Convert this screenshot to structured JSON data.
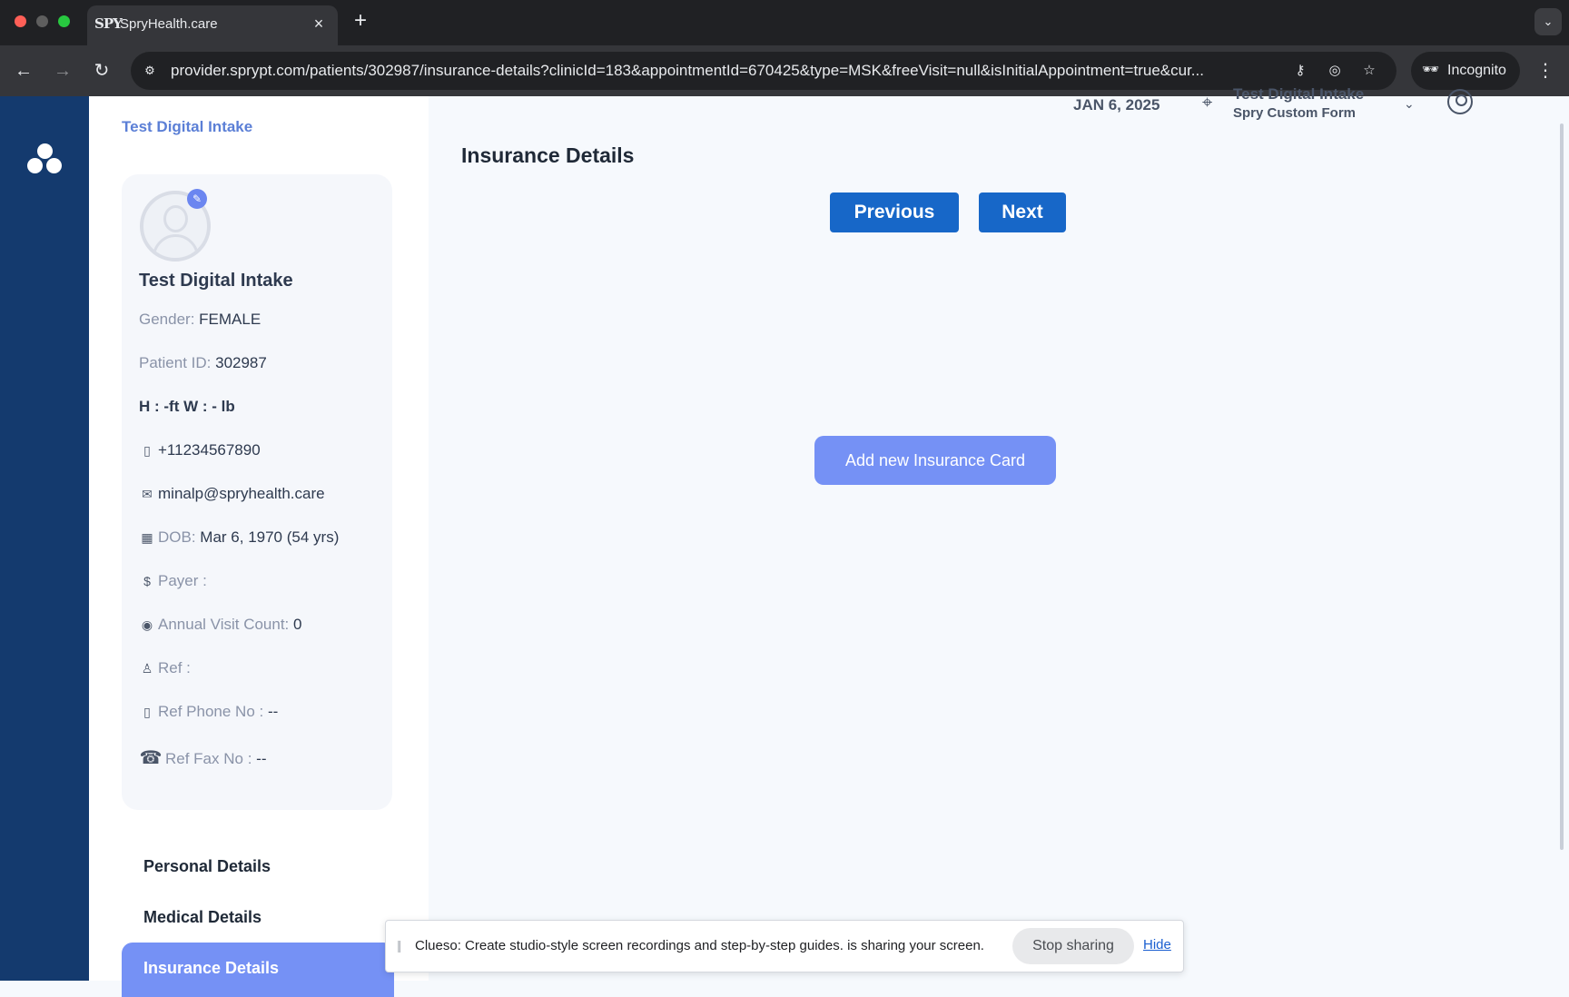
{
  "browser": {
    "tab_title": "SpryHealth.care",
    "tab_favicon_text": "SPY",
    "url": "provider.sprypt.com/patients/302987/insurance-details?clinicId=183&appointmentId=670425&type=MSK&freeVisit=null&isInitialAppointment=true&cur...",
    "incognito_label": "Incognito"
  },
  "sidebar": {
    "breadcrumb": "Test Digital Intake",
    "patient": {
      "name": "Test Digital Intake",
      "gender_label": "Gender:",
      "gender_value": "FEMALE",
      "id_label": "Patient ID:",
      "id_value": "302987",
      "height_weight": "H : -ft W : - lb",
      "phone": "+11234567890",
      "email": "minalp@spryhealth.care",
      "dob_label": "DOB:",
      "dob_value": "Mar 6, 1970 (54 yrs)",
      "payer_label": "Payer :",
      "visit_count_label": "Annual Visit Count:",
      "visit_count_value": "0",
      "ref_label": "Ref :",
      "ref_phone_label": "Ref Phone No :",
      "ref_phone_value": "--",
      "ref_fax_label": "Ref Fax No :",
      "ref_fax_value": "--"
    },
    "nav": {
      "personal": "Personal Details",
      "medical": "Medical Details",
      "insurance": "Insurance Details"
    }
  },
  "header": {
    "date": "JAN 6, 2025",
    "location_name": "Test Digital Intake",
    "location_form": "Spry Custom Form"
  },
  "main": {
    "title": "Insurance Details",
    "previous_label": "Previous",
    "next_label": "Next",
    "add_card_label": "Add new Insurance Card"
  },
  "sharebar": {
    "message": "Clueso: Create studio-style screen recordings and step-by-step guides. is sharing your screen.",
    "stop_label": "Stop sharing",
    "hide_label": "Hide"
  },
  "colors": {
    "rail": "#143a6e",
    "primary_button": "#1767c8",
    "accent": "#7591f5",
    "breadcrumb": "#5b7fd6"
  },
  "icons": [
    "spry-logo-icon",
    "edit-icon",
    "phone-icon",
    "mail-icon",
    "calendar-icon",
    "payer-icon",
    "eye-icon",
    "person-icon",
    "fax-icon",
    "location-pin-icon",
    "chevron-down-icon",
    "user-account-icon"
  ]
}
